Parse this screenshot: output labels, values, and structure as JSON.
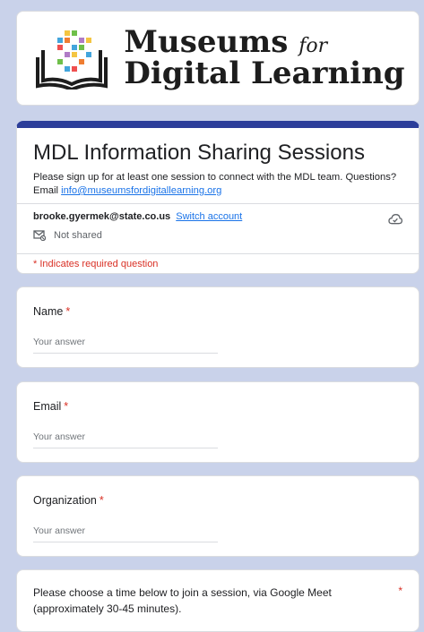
{
  "banner": {
    "logo_line1": "Museums",
    "logo_for": "for",
    "logo_line2": "Digital Learning"
  },
  "header": {
    "title": "MDL Information Sharing Sessions",
    "description": "Please sign up for at least one session to connect with the MDL team. Questions? Email",
    "email_link": "info@museumsfordigitallearning.org",
    "account_email": "brooke.gyermek@state.co.us",
    "switch_account": "Switch account",
    "not_shared": "Not shared",
    "required_note": "* Indicates required question"
  },
  "questions": [
    {
      "label": "Name",
      "required_mark": "*",
      "placeholder": "Your answer"
    },
    {
      "label": "Email",
      "required_mark": "*",
      "placeholder": "Your answer"
    },
    {
      "label": "Organization",
      "required_mark": "*",
      "placeholder": "Your answer"
    },
    {
      "label": "Please choose a time below to join a session, via Google Meet (approximately 30-45 minutes).",
      "required_mark": "*"
    }
  ],
  "colors": {
    "background": "#c9d2ea",
    "accent": "#2c3e9a",
    "link": "#1a73e8",
    "required": "#d93025"
  },
  "icons": [
    "logo-book-icon",
    "cloud-icon",
    "not-shared-icon"
  ]
}
